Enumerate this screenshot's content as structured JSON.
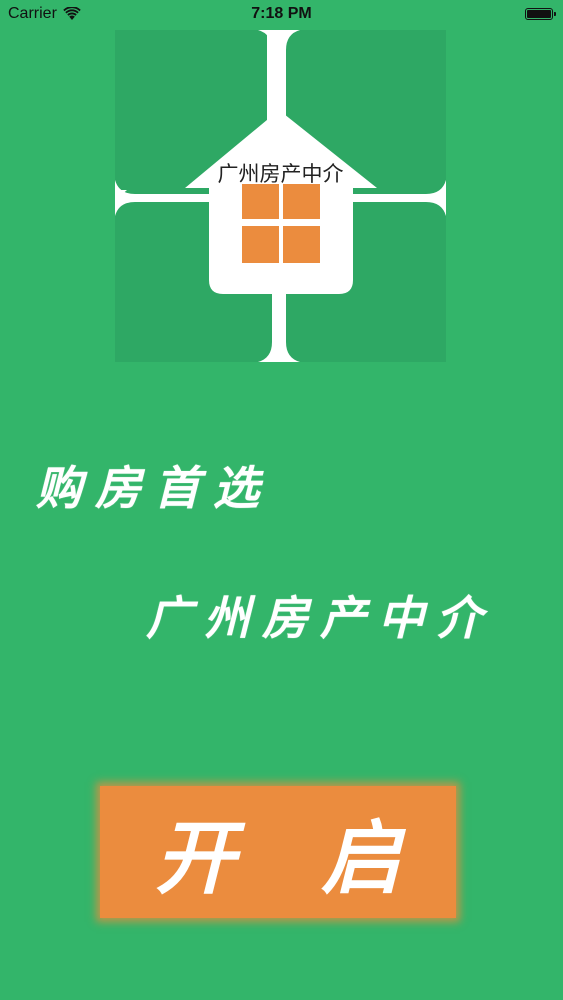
{
  "status_bar": {
    "carrier": "Carrier",
    "time": "7:18 PM",
    "battery_level": 1.0,
    "icons": [
      "wifi-icon",
      "battery-icon"
    ]
  },
  "logo": {
    "text": "广州房产中介",
    "icon": "house-icon",
    "colors": {
      "background_tiles": "#2ea864",
      "house": "#ffffff",
      "window": "#eb8c3e"
    }
  },
  "slogan": {
    "line1": "购房首选",
    "line2": "广州房产中介"
  },
  "start_button": {
    "label": "开启"
  },
  "colors": {
    "background": "#33b56a",
    "accent": "#eb8c3e",
    "text_light": "#ffffff"
  }
}
